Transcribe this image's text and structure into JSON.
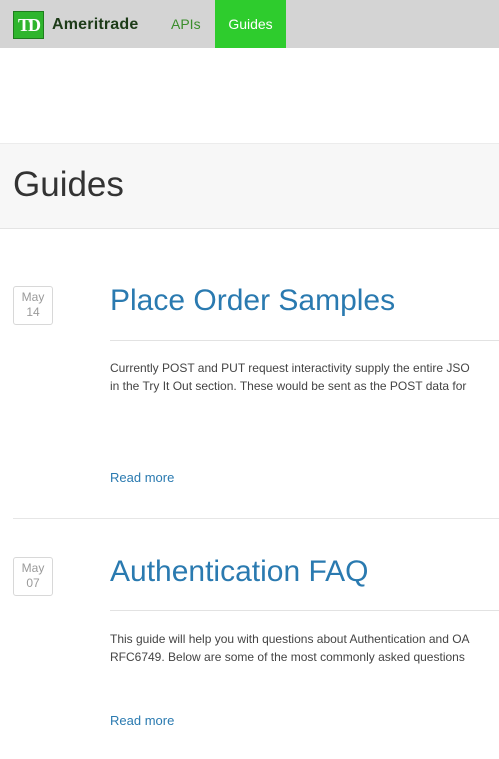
{
  "brand": {
    "logo_mark": "TD",
    "name": "Ameritrade"
  },
  "nav": {
    "items": [
      {
        "label": "APIs",
        "active": false
      },
      {
        "label": "Guides",
        "active": true
      }
    ]
  },
  "page": {
    "title": "Guides"
  },
  "colors": {
    "nav_active": "#2ecc2d",
    "link": "#2a7ab0",
    "topbar": "#d4d4d4"
  },
  "articles": [
    {
      "month": "May",
      "day": "14",
      "title": "Place Order Samples",
      "excerpt_lines": [
        "Currently POST and PUT request interactivity supply the entire JSO",
        "in the Try It Out section. These would be sent as the POST data for"
      ],
      "read_more": "Read more"
    },
    {
      "month": "May",
      "day": "07",
      "title": "Authentication FAQ",
      "excerpt_lines": [
        "This guide will help you with questions about Authentication and OA",
        "RFC6749. Below are some of the most commonly asked questions"
      ],
      "read_more": "Read more"
    }
  ]
}
